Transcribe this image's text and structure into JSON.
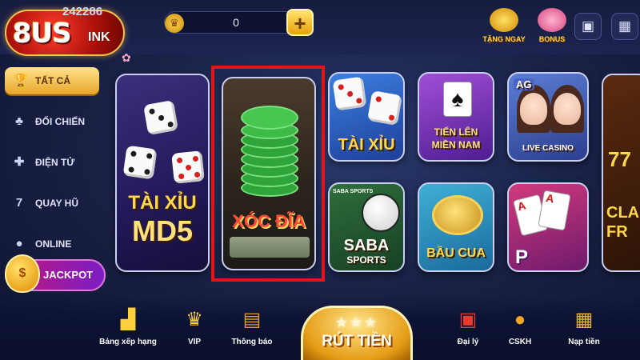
{
  "header": {
    "logo_text": "8US",
    "logo_sub": "INK",
    "user_id": "242286",
    "balance": "0",
    "plus_label": "+",
    "promo_gift_label": "TẶNG NGAY",
    "promo_bonus_label": "BONUS"
  },
  "sidebar": {
    "items": [
      {
        "label": "TẤT CẢ"
      },
      {
        "label": "ĐỐI CHIẾN"
      },
      {
        "label": "ĐIỆN TỬ"
      },
      {
        "label": "QUAY HŨ"
      },
      {
        "label": "ONLINE"
      }
    ],
    "jackpot_label": "JACKPOT"
  },
  "games": {
    "taixiu_md5": {
      "line1": "TÀI XỈU",
      "line2": "MD5"
    },
    "xocdia": {
      "label": "XÓC ĐĨA"
    },
    "taixiu": {
      "label": "TÀI XỈU"
    },
    "tienlen": {
      "line1": "TIẾN LÊN",
      "line2": "MIỀN NAM"
    },
    "agcasino": {
      "brand": "AG",
      "label": "LIVE CASINO"
    },
    "saba": {
      "line1": "SABA",
      "line2": "SPORTS",
      "top": "SABA SPORTS"
    },
    "baucua": {
      "label": "BẦU CUA"
    },
    "poker": {
      "label": "P"
    },
    "slot": {
      "line1": "CLA",
      "line2": "FR",
      "sevens": "77"
    }
  },
  "bottom_nav": {
    "rank": "Bảng xếp hạng",
    "vip": "VIP",
    "notice": "Thông báo",
    "withdraw": "RÚT TIỀN",
    "agent": "Đại lý",
    "support": "CSKH",
    "deposit": "Nạp tiền"
  },
  "colors": {
    "highlight": "#e1161b",
    "accent_gold": "#e7a72a",
    "background": "#1a2247"
  },
  "icons": [
    "crown-icon",
    "plus-icon",
    "gift-icon",
    "piggy-bank-icon",
    "bag-icon",
    "calendar-icon",
    "trophy-icon",
    "cards-icon",
    "gamepad-icon",
    "slot-icon",
    "user-icon",
    "podium-icon",
    "vip-crown-icon",
    "chest-icon",
    "gift-box-icon",
    "headset-egg-icon",
    "shop-icon"
  ]
}
